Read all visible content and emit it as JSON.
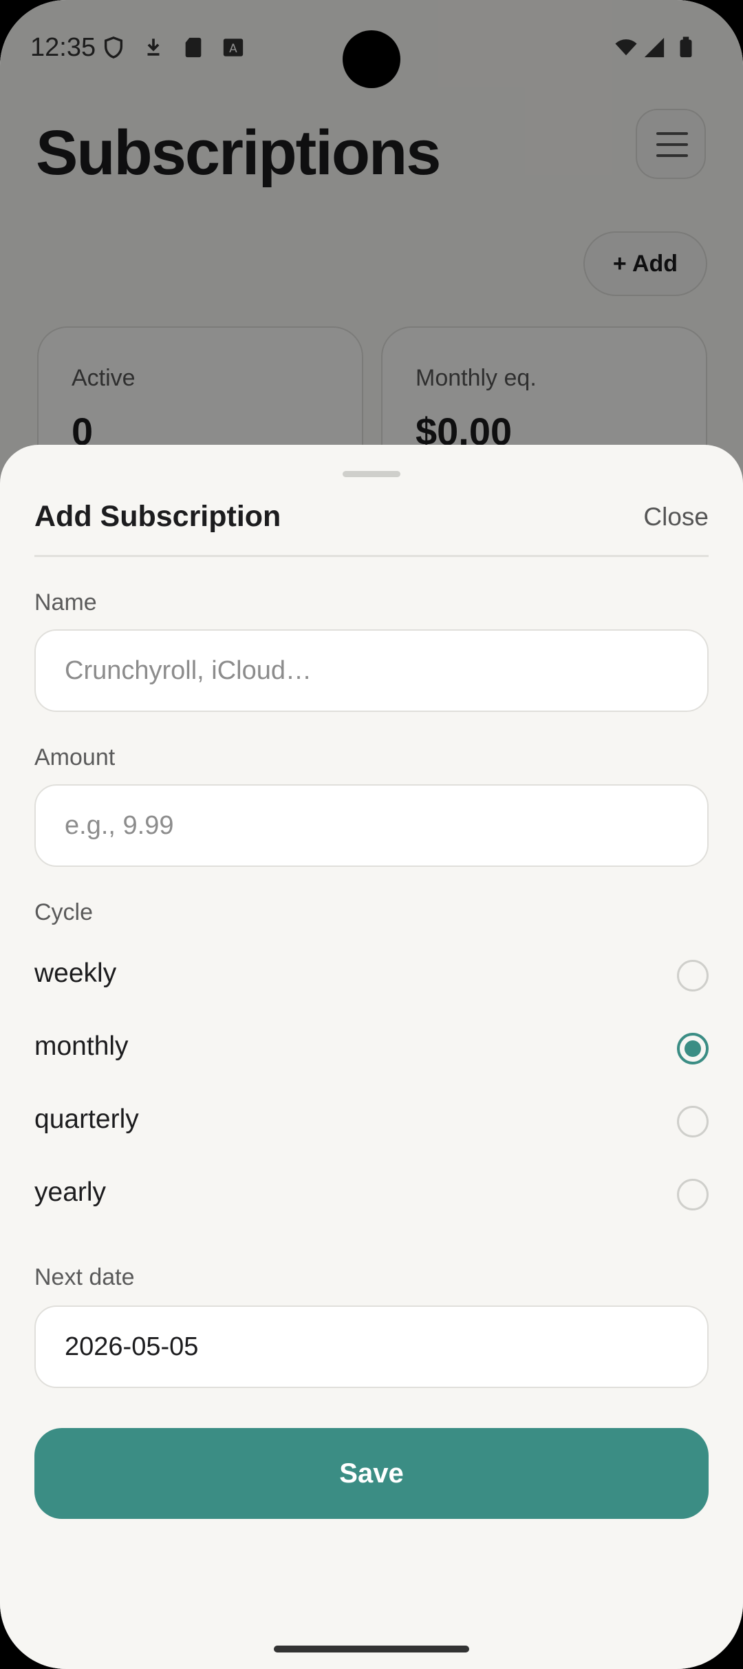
{
  "status_bar": {
    "time": "12:35",
    "left_icons": [
      "shield-icon",
      "download-icon",
      "sd-card-icon",
      "keyboard-a-icon"
    ],
    "right_icons": [
      "wifi-icon",
      "cellular-signal-icon",
      "battery-icon"
    ]
  },
  "app": {
    "title": "Subscriptions",
    "menu_icon": "hamburger-menu-icon",
    "add_label": "+ Add",
    "stats": [
      {
        "label": "Active",
        "value": "0"
      },
      {
        "label": "Monthly eq.",
        "value": "$0.00"
      }
    ]
  },
  "sheet": {
    "title": "Add Subscription",
    "close_label": "Close",
    "name_label": "Name",
    "name_placeholder": "Crunchyroll, iCloud…",
    "amount_label": "Amount",
    "amount_placeholder": "e.g., 9.99",
    "cycle_label": "Cycle",
    "cycles": [
      {
        "label": "weekly",
        "selected": false
      },
      {
        "label": "monthly",
        "selected": true
      },
      {
        "label": "quarterly",
        "selected": false
      },
      {
        "label": "yearly",
        "selected": false
      }
    ],
    "next_date_label": "Next date",
    "next_date_value": "2026-05-05",
    "save_label": "Save"
  },
  "colors": {
    "accent": "#3b8d84",
    "sheet_bg": "#f7f6f3"
  }
}
